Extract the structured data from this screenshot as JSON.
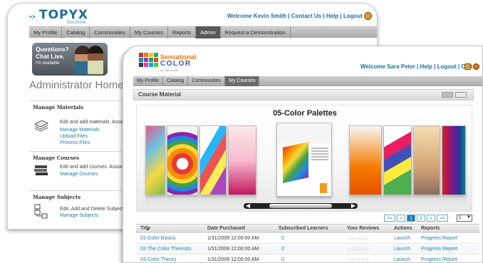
{
  "back_window": {
    "logo": {
      "brand": "TOPYX",
      "tagline": "Test Drive"
    },
    "top_links": {
      "welcome": "Welcome Kevin Smith",
      "contact": "Contact Us",
      "help": "Help",
      "logout": "Logout",
      "sep": "|"
    },
    "nav_tabs": [
      {
        "label": "My Profile"
      },
      {
        "label": "Catalog"
      },
      {
        "label": "Communities"
      },
      {
        "label": "My Courses"
      },
      {
        "label": "Reports"
      },
      {
        "label": "Admin"
      },
      {
        "label": "Request a Demonstration"
      }
    ],
    "active_tab": "Admin",
    "chat_banner": {
      "line1": "Questions?",
      "line2": "Chat Live.",
      "line3": "I'm Available"
    },
    "page_title": "Administrator Home",
    "sections": [
      {
        "title": "Manage Materials",
        "icon": "document-stack-icon",
        "desc": "Edit and add materials. Asso",
        "links": [
          "Manage Materials",
          "Upload Files",
          "Process Files"
        ]
      },
      {
        "title": "Manage Courses",
        "icon": "books-icon",
        "desc": "Edit and add courses. Assoc",
        "links": [
          "Manage Courses"
        ]
      },
      {
        "title": "Manage Subjects",
        "icon": "subject-tree-icon",
        "desc": "Edit, Add and Delete Subjects",
        "links": [
          "Manage Subjects"
        ]
      }
    ]
  },
  "front_window": {
    "logo": {
      "line1": "Sensational",
      "line2": "COLOR",
      "line3": "by Kate Smith"
    },
    "top_links": {
      "welcome": "Welcome Sara Peter",
      "help": "Help",
      "logout": "Logout",
      "cart": "Cart",
      "sep": "|"
    },
    "nav_tabs": [
      {
        "label": "My Profile"
      },
      {
        "label": "Catalog"
      },
      {
        "label": "Communities"
      },
      {
        "label": "My Courses"
      }
    ],
    "active_tab": "My Courses",
    "section_title": "Course Material",
    "gallery": {
      "featured_title": "05-Color Palettes"
    },
    "pager": {
      "first": "<<",
      "prev": "<",
      "pages": [
        "1",
        "2"
      ],
      "current": "1",
      "next": ">",
      "last": ">>",
      "select_value": "1"
    },
    "table": {
      "headers": [
        "Title",
        "Date Purchased",
        "Subscribed Learners",
        "Your Reviews",
        "Actions",
        "Reports"
      ],
      "rows": [
        {
          "title": "01-Color Basics",
          "date": "1/31/2009 12:00:00 AM",
          "learners": "0",
          "stars": "☆☆☆☆☆",
          "action": "Launch",
          "report": "Progress Report"
        },
        {
          "title": "02-The Color Theorists",
          "date": "1/31/2009 12:00:00 AM",
          "learners": "0",
          "stars": "☆☆☆☆☆",
          "action": "Launch",
          "report": "Progress Report"
        },
        {
          "title": "03-Color Theory",
          "date": "1/31/2009 12:00:00 AM",
          "learners": "0",
          "stars": "☆☆☆☆☆",
          "action": "Launch",
          "report": "Progress Report"
        }
      ]
    }
  },
  "colors": {
    "link": "#1d7fa7",
    "brand_blue": "#1d6f9b",
    "brand_orange": "#e8731a",
    "nav_active": "#5a5a5a"
  }
}
